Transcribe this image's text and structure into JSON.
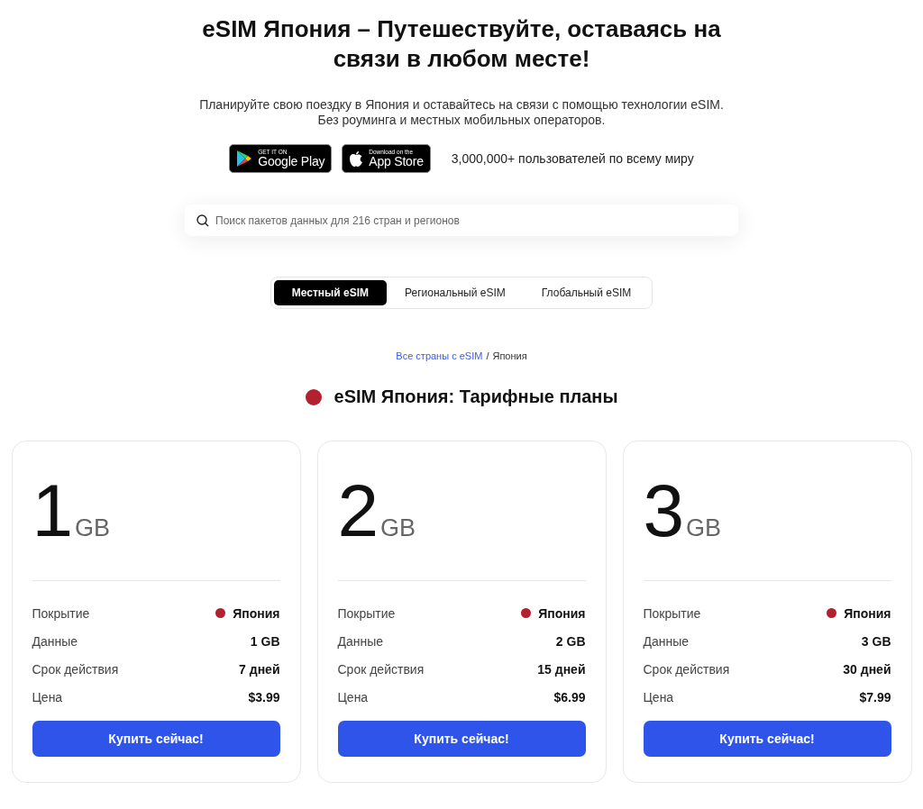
{
  "title": "eSIM Япония – Путешествуйте, оставаясь на связи в любом месте!",
  "subtitle_lines": [
    "Планируйте свою поездку в Япония и оставайтесь на связи с помощью технологии eSIM.",
    "Без роуминга и местных мобильных операторов."
  ],
  "store_badges": [
    {
      "kind": "google",
      "small": "GET IT ON",
      "big": "Google Play"
    },
    {
      "kind": "apple",
      "small": "Download on the",
      "big": "App Store"
    }
  ],
  "users_note": "3,000,000+ пользователей по всему миру",
  "search": {
    "placeholder": "Поиск пакетов данных для 216 стран и регионов"
  },
  "tabs": [
    {
      "label": "Местный eSIM",
      "selected": true
    },
    {
      "label": "Региональный eSIM",
      "selected": false
    },
    {
      "label": "Глобальный eSIM",
      "selected": false
    }
  ],
  "breadcrumb": {
    "link": "Все страны с eSIM",
    "separator": "/",
    "current": "Япония"
  },
  "section_title": "eSIM Япония: Тарифные планы",
  "plans": [
    {
      "amount": "1",
      "unit": "GB",
      "rows": [
        {
          "label": "Покрытие",
          "value": "Япония",
          "kind": "country"
        },
        {
          "label": "Данные",
          "value": "1 GB",
          "kind": "text"
        },
        {
          "label": "Срок действия",
          "value": "7 дней",
          "kind": "text"
        },
        {
          "label": "Цена",
          "value": "$3.99",
          "kind": "text"
        }
      ],
      "button": "Купить сейчас!"
    },
    {
      "amount": "2",
      "unit": "GB",
      "rows": [
        {
          "label": "Покрытие",
          "value": "Япония",
          "kind": "country"
        },
        {
          "label": "Данные",
          "value": "2 GB",
          "kind": "text"
        },
        {
          "label": "Срок действия",
          "value": "15 дней",
          "kind": "text"
        },
        {
          "label": "Цена",
          "value": "$6.99",
          "kind": "text"
        }
      ],
      "button": "Купить сейчас!"
    },
    {
      "amount": "3",
      "unit": "GB",
      "rows": [
        {
          "label": "Покрытие",
          "value": "Япония",
          "kind": "country"
        },
        {
          "label": "Данные",
          "value": "3 GB",
          "kind": "text"
        },
        {
          "label": "Срок действия",
          "value": "30 дней",
          "kind": "text"
        },
        {
          "label": "Цена",
          "value": "$7.99",
          "kind": "text"
        }
      ],
      "button": "Купить сейчас!"
    }
  ]
}
